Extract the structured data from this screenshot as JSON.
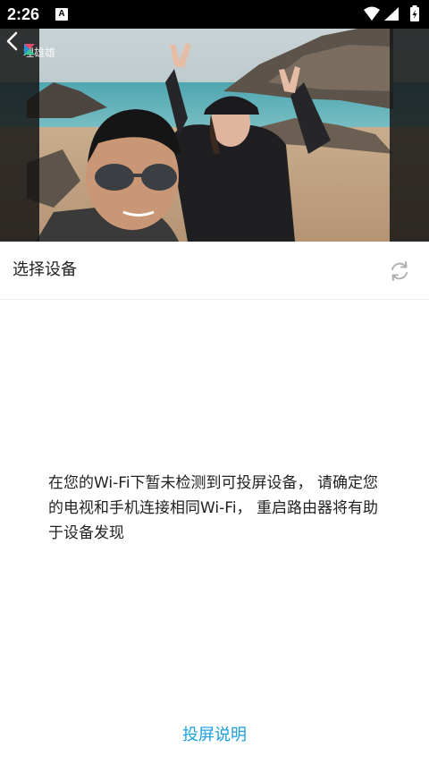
{
  "status_bar": {
    "time": "2:26",
    "notification_icon": "A"
  },
  "video": {
    "watermark": "埋雄雄"
  },
  "device_section": {
    "title": "选择设备",
    "empty_message": "在您的Wi-Fi下暂未检测到可投屏设备， 请确定您的电视和手机连接相同Wi-Fi， 重启路由器将有助于设备发现"
  },
  "help_link": "投屏说明",
  "colors": {
    "link": "#1aa0dc",
    "status_bar": "#000000"
  }
}
